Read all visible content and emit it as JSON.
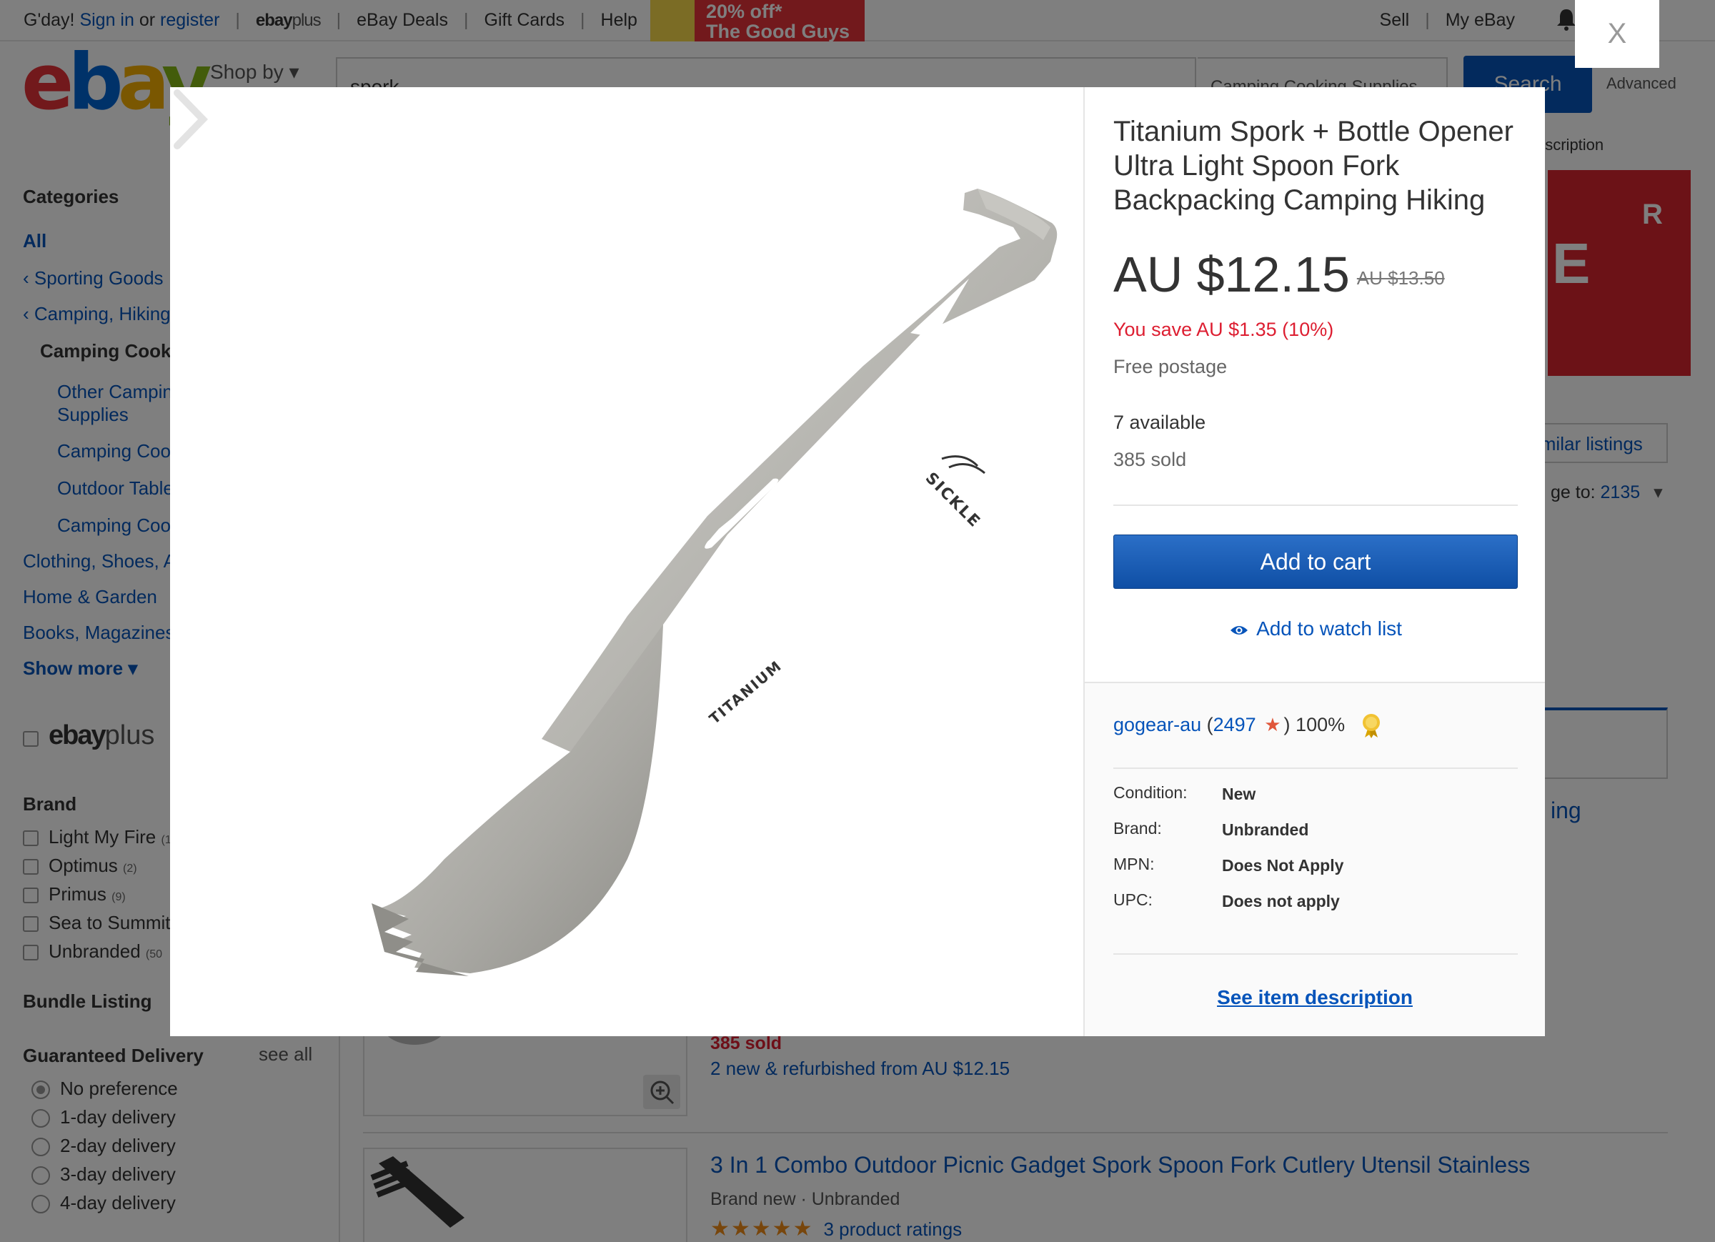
{
  "background": {
    "topbar": {
      "greeting": "G'day!",
      "sign_in": "Sign in",
      "or": "or",
      "register": "register",
      "ebayplus_brand": "ebay",
      "ebayplus_suffix": "plus",
      "links": [
        "eBay Deals",
        "Gift Cards",
        "Help"
      ],
      "promo_line1": "20% off*",
      "promo_line2": "The Good Guys",
      "sell": "Sell",
      "my_ebay": "My eBay"
    },
    "logo": [
      "e",
      "b",
      "a",
      "y"
    ],
    "shop_by": "Shop by",
    "search_value": "spork",
    "category_value": "Camping Cooking Supplies",
    "search_button": "Search",
    "advanced": "Advanced",
    "description_fragment": "escription",
    "sidebar": {
      "categories_heading": "Categories",
      "all": "All",
      "crumbs": [
        "Sporting Goods",
        "Camping, Hiking"
      ],
      "current": "Camping Cook",
      "subcats": [
        "Other Camping Supplies",
        "Camping Coo",
        "Outdoor Table",
        "Camping Coo"
      ],
      "other_cats": [
        "Clothing, Shoes, A",
        "Home & Garden",
        "Books, Magazines"
      ],
      "show_more": "Show more",
      "ebayplus_brand": "ebay",
      "ebayplus_suffix": "plus",
      "brand_heading": "Brand",
      "brands": [
        {
          "name": "Light My Fire",
          "count": "(1"
        },
        {
          "name": "Optimus",
          "count": "(2)"
        },
        {
          "name": "Primus",
          "count": "(9)"
        },
        {
          "name": "Sea to Summit",
          "count": ""
        },
        {
          "name": "Unbranded",
          "count": "(50"
        }
      ],
      "bundle_heading": "Bundle Listing",
      "delivery_heading": "Guaranteed Delivery",
      "see_all": "see all",
      "delivery_options": [
        "No preference",
        "1-day delivery",
        "2-day delivery",
        "3-day delivery",
        "4-day delivery"
      ]
    },
    "right": {
      "banner_text": "E",
      "banner_text_small": "R",
      "similar_listings": "imilar listings",
      "ship_to_label": "ge to:",
      "ship_to_value": "2135",
      "listing_fragment": "ing"
    },
    "results": [
      {
        "sold": "385 sold",
        "new_refurb": "2 new & refurbished from AU $12.15"
      },
      {
        "title": "3 In 1 Combo Outdoor Picnic Gadget Spork Spoon Fork Cutlery Utensil Stainless",
        "subtitle": "Brand new · Unbranded",
        "stars": "★★★★★",
        "ratings": "3 product ratings"
      }
    ]
  },
  "modal": {
    "close_label": "X",
    "image_engravings": [
      "SICKLE",
      "TITANIUM"
    ],
    "title": "Titanium Spork + Bottle Opener Ultra Light Spoon Fork Backpacking Camping Hiking",
    "price": "AU $12.15",
    "original_price": "AU $13.50",
    "savings": "You save AU $1.35 (10%)",
    "postage": "Free postage",
    "available": "7 available",
    "sold": "385 sold",
    "add_to_cart": "Add to cart",
    "add_to_watch": "Add to watch list",
    "seller": {
      "name": "gogear-au",
      "open_paren": "(",
      "feedback": "2497",
      "close_paren": ")",
      "percent": "100%"
    },
    "specs": [
      {
        "label": "Condition:",
        "value": "New"
      },
      {
        "label": "Brand:",
        "value": "Unbranded"
      },
      {
        "label": "MPN:",
        "value": "Does Not Apply"
      },
      {
        "label": "UPC:",
        "value": "Does not apply"
      }
    ],
    "see_description": "See item description"
  },
  "colors": {
    "ebay_red": "#e53238",
    "ebay_blue": "#0064d2",
    "ebay_yellow": "#f5af02",
    "ebay_green": "#86b817",
    "link_blue": "#0654ba",
    "savings_red": "#dd1e31",
    "button_blue": "#1a5db7"
  },
  "icons": [
    "bell-icon",
    "chevron-right-icon",
    "eye-icon",
    "star-icon",
    "badge-icon",
    "zoom-icon",
    "close-icon"
  ]
}
